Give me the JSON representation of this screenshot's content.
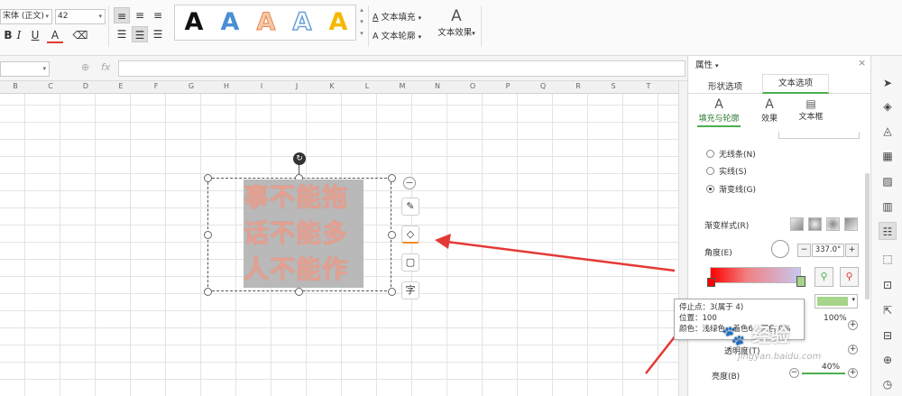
{
  "ribbon": {
    "font_name": "宋体 (正文)",
    "font_size": "42",
    "bold": "B",
    "italic": "I",
    "underline": "U",
    "font_color": "A",
    "styles": [
      {
        "glyph": "A",
        "color": "#111111"
      },
      {
        "glyph": "A",
        "color": "#4a8fd6"
      },
      {
        "glyph": "A",
        "color": "#f0a070"
      },
      {
        "glyph": "A",
        "color": "#9ec3ea"
      },
      {
        "glyph": "A",
        "color": "#f5b800"
      }
    ],
    "text_fill_label": "文本填充",
    "text_outline_label": "文本轮廓",
    "text_effect_label": "文本效果"
  },
  "formula_bar": {
    "fx": "fx"
  },
  "sheet": {
    "columns": [
      "B",
      "C",
      "D",
      "E",
      "F",
      "G",
      "H",
      "I",
      "J",
      "K",
      "L",
      "M",
      "N",
      "O",
      "P",
      "Q",
      "R",
      "S",
      "T"
    ]
  },
  "text_shape": {
    "lines": [
      "事不能拖",
      "话不能多",
      "人不能作"
    ]
  },
  "panel": {
    "title": "属性",
    "tabs": [
      "形状选项",
      "文本选项"
    ],
    "subtabs": [
      "填充与轮廓",
      "效果",
      "文本框"
    ],
    "line_options": [
      "无线条(N)",
      "实线(S)",
      "渐变线(G)"
    ],
    "gradient_style_label": "渐变样式(R)",
    "angle_label": "角度(E)",
    "angle_value": "337.0°",
    "brightness_label": "亮度(B)",
    "transparency_label": "透明度(T)",
    "transparency_value": "100%",
    "brightness_value": "40%"
  },
  "tooltip": {
    "line1": "停止点：3(属于 4)",
    "line2": "位置：100",
    "line3": "颜色：浅绿色，着色6，深色 0%"
  },
  "watermark": {
    "text": "经验",
    "url": "jingyan.baidu.com"
  },
  "colors": {
    "accent": "#4caf50",
    "arrow": "#e53935",
    "gradient_start": "#ff0000",
    "gradient_end": "#c8c8f0",
    "stop_color": "#a5d48a"
  }
}
